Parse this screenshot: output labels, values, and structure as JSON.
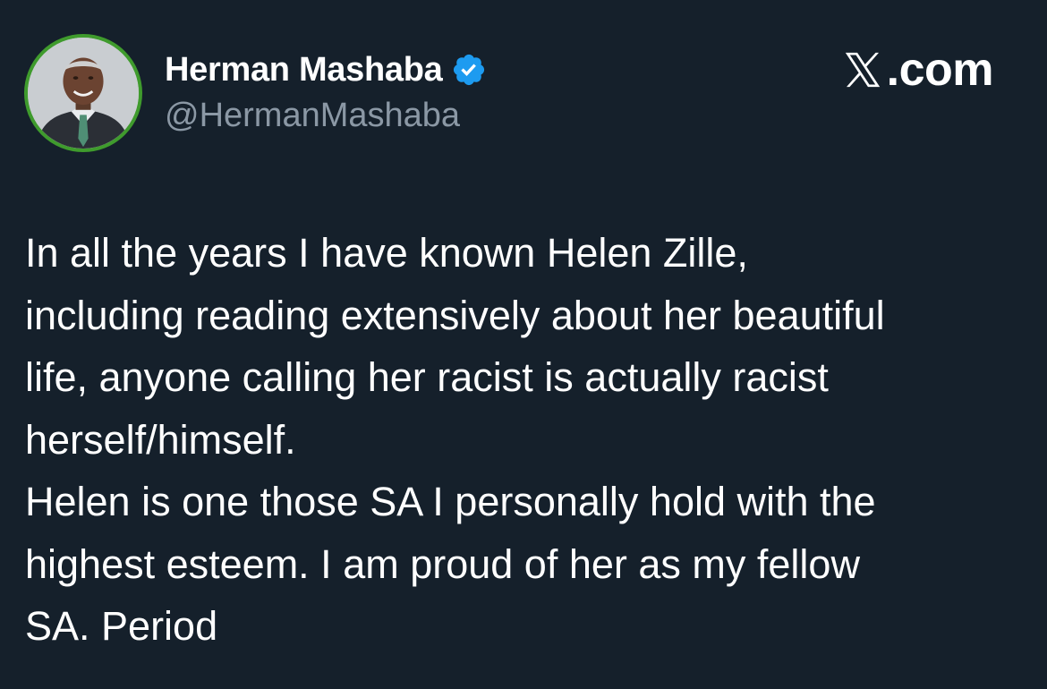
{
  "author": {
    "display_name": "Herman Mashaba",
    "handle": "@HermanMashaba",
    "verified": true,
    "avatar_icon": "profile-photo",
    "avatar_ring_color": "#3f9b2d"
  },
  "brand": {
    "text": ".com",
    "logo_icon": "x-logo-icon"
  },
  "tweet": {
    "lines": [
      "In all the years I have known Helen Zille,",
      "including reading extensively about her beautiful",
      "life, anyone calling her racist is actually racist",
      "herself/himself.",
      "Helen is one those SA I personally hold with the",
      "highest esteem. I am proud of her as my fellow",
      "SA. Period"
    ]
  },
  "colors": {
    "background": "#15202b",
    "text": "#ffffff",
    "secondary_text": "#8b98a5",
    "verified_badge": "#1d9bf0"
  }
}
